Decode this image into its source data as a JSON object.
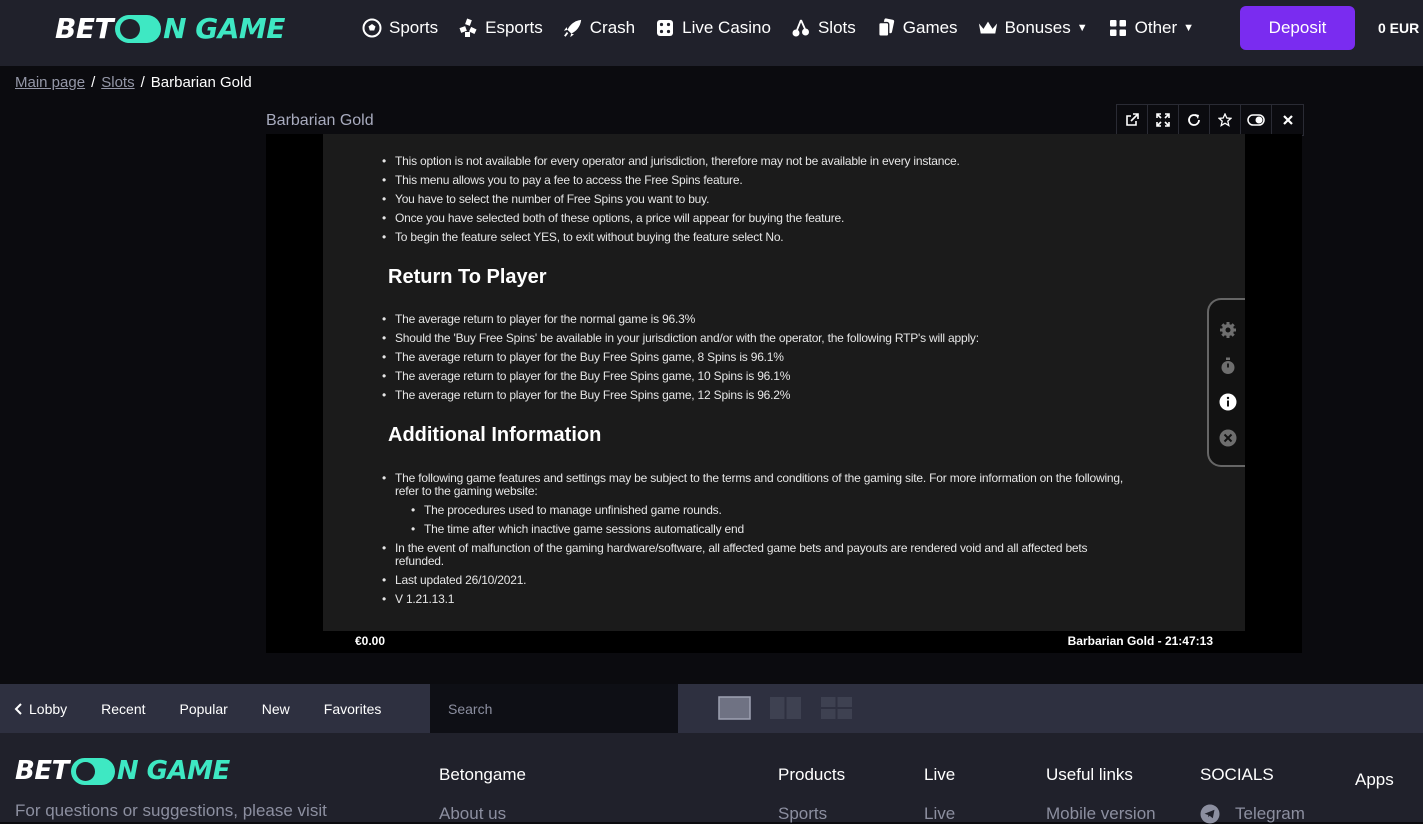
{
  "brand": {
    "part1": "BET",
    "part2": "N GAME"
  },
  "nav": [
    {
      "label": "Sports",
      "icon": "soccer-ball-icon"
    },
    {
      "label": "Esports",
      "icon": "gamepad-icon"
    },
    {
      "label": "Crash",
      "icon": "rocket-icon"
    },
    {
      "label": "Live Casino",
      "icon": "dice-icon"
    },
    {
      "label": "Slots",
      "icon": "cherries-icon"
    },
    {
      "label": "Games",
      "icon": "cards-icon"
    },
    {
      "label": "Bonuses",
      "icon": "crown-icon"
    },
    {
      "label": "Other",
      "icon": "grid-icon"
    }
  ],
  "deposit_label": "Deposit",
  "balance": "0 EUR",
  "breadcrumb": {
    "home": "Main page",
    "section": "Slots",
    "current": "Barbarian Gold"
  },
  "game": {
    "title": "Barbarian Gold",
    "balance": "€0.00",
    "status": "Barbarian Gold - 21:47:13"
  },
  "info": {
    "list1": [
      "This option is not available for every operator and jurisdiction, therefore may not be available in every instance.",
      "This menu allows you to pay a fee to access the Free Spins feature.",
      "You have to select the number of Free Spins you want to buy.",
      "Once you have selected both of these options, a price will appear for buying the feature.",
      "To begin the feature select YES, to exit without buying the feature select No."
    ],
    "h_rtp": "Return To Player",
    "rtp": [
      "The average return to player for the normal game is 96.3%",
      "Should the 'Buy Free Spins' be available in your jurisdiction and/or with the operator, the following RTP's will apply:",
      "The average return to player for the Buy Free Spins game, 8 Spins is 96.1%",
      "The average return to player for the Buy Free Spins game, 10 Spins is 96.1%",
      "The average return to player for the Buy Free Spins game, 12 Spins is 96.2%"
    ],
    "h_add": "Additional Information",
    "add_intro": "The following game features and settings may be subject to the terms and conditions of the gaming site. For more information on the following, refer to the gaming website:",
    "add_sub": [
      "The procedures used to manage unfinished game rounds.",
      "The time after which inactive game sessions automatically end"
    ],
    "add_rest": [
      "In the event of malfunction of the gaming hardware/software, all affected game bets and payouts are rendered void and all affected bets refunded.",
      "Last updated 26/10/2021.",
      "V 1.21.13.1"
    ]
  },
  "lobby": {
    "back": "Lobby",
    "tabs": [
      "Recent",
      "Popular",
      "New",
      "Favorites"
    ],
    "search_placeholder": "Search"
  },
  "footer": {
    "text": "For questions or suggestions, please visit",
    "col_betongame": "Betongame",
    "about": "About us",
    "col_products": "Products",
    "sports": "Sports",
    "col_live": "Live",
    "live": "Live",
    "col_useful": "Useful links",
    "mobile": "Mobile version",
    "col_socials": "SOCIALS",
    "telegram": "Telegram",
    "apps": "Apps"
  },
  "colors": {
    "accent": "#3ee8c3",
    "deposit": "#7a2cf0",
    "topbar": "#20212b"
  }
}
